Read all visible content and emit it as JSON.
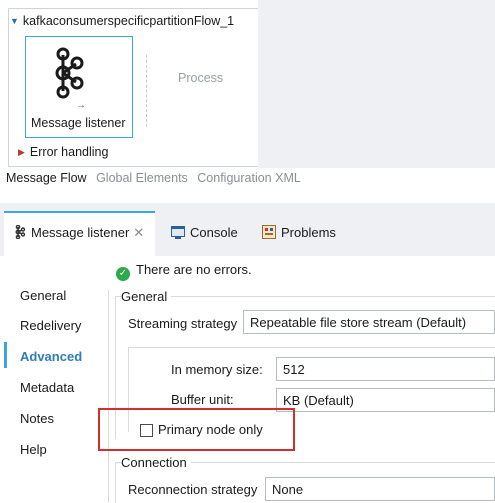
{
  "flow": {
    "title": "kafkaconsumerspecificpartitionFlow_1",
    "source_label": "Message listener",
    "process_label": "Process",
    "error_handling_label": "Error handling"
  },
  "flow_tabs": [
    "Message Flow",
    "Global Elements",
    "Configuration XML"
  ],
  "panel_tabs": {
    "listener": "Message listener",
    "console": "Console",
    "problems": "Problems"
  },
  "status": "There are no errors.",
  "nav": [
    "General",
    "Redelivery",
    "Advanced",
    "Metadata",
    "Notes",
    "Help"
  ],
  "nav_active": "Advanced",
  "general": {
    "group_label": "General",
    "streaming_strategy_label": "Streaming strategy",
    "streaming_strategy_value": "Repeatable file store stream (Default)",
    "in_memory_size_label": "In memory size:",
    "in_memory_size_value": "512",
    "buffer_unit_label": "Buffer unit:",
    "buffer_unit_value": "KB (Default)",
    "primary_node_only_label": "Primary node only",
    "primary_node_only_checked": false
  },
  "connection": {
    "group_label": "Connection",
    "reconnection_strategy_label": "Reconnection strategy",
    "reconnection_strategy_value": "None"
  },
  "colors": {
    "accent": "#3aa7de",
    "highlight": "#d0312d",
    "ok": "#2eaa4a"
  }
}
